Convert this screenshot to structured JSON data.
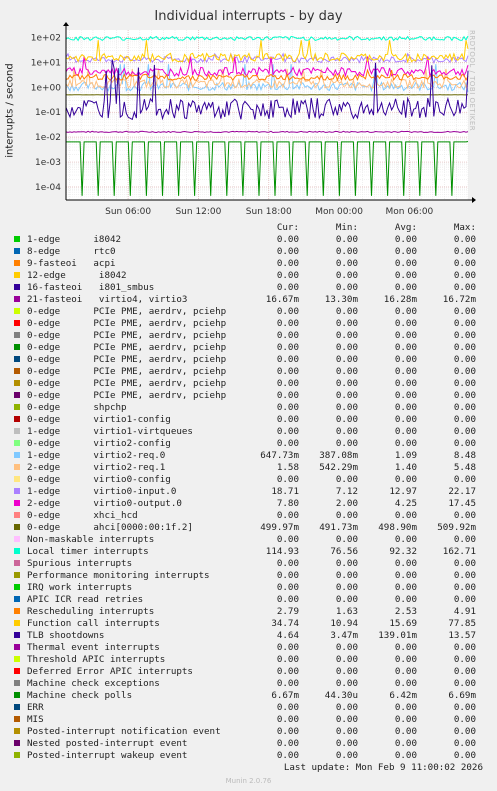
{
  "title": "Individual interrupts - by day",
  "side_label": "RRDTOOL / TOBI OETIKER",
  "footer": "Last update:  Mon Feb  9 11:00:02 2026",
  "munin": "Munin 2.0.76",
  "chart_data": {
    "type": "line",
    "yscale": "log",
    "ylabel": "interrupts / second",
    "ylim": [
      3e-05,
      200
    ],
    "yticks": [
      "1e+02",
      "1e+01",
      "1e+00",
      "1e-01",
      "1e-02",
      "1e-03",
      "1e-04"
    ],
    "ytick_values": [
      100,
      10,
      1,
      0.1,
      0.01,
      0.001,
      0.0001
    ],
    "xticks": [
      "Sun 06:00",
      "Sun 12:00",
      "Sun 18:00",
      "Mon 00:00",
      "Mon 06:00"
    ],
    "xtick_hours": [
      6,
      12,
      18,
      24,
      30
    ],
    "xlim_hours": [
      0.7,
      35.0
    ],
    "grid": true,
    "legend_columns": [
      "Cur:",
      "Min:",
      "Avg:",
      "Max:"
    ],
    "series": [
      {
        "name": "1-edge      i8042",
        "color": "#00cc00",
        "cur": "0.00",
        "min": "0.00",
        "avg": "0.00",
        "max": "0.00"
      },
      {
        "name": "8-edge      rtc0",
        "color": "#0066b3",
        "cur": "0.00",
        "min": "0.00",
        "avg": "0.00",
        "max": "0.00"
      },
      {
        "name": "9-fasteoi   acpi",
        "color": "#ff8000",
        "cur": "0.00",
        "min": "0.00",
        "avg": "0.00",
        "max": "0.00"
      },
      {
        "name": "12-edge      i8042",
        "color": "#ffcc00",
        "cur": "0.00",
        "min": "0.00",
        "avg": "0.00",
        "max": "0.00"
      },
      {
        "name": "16-fasteoi   i801_smbus",
        "color": "#330099",
        "cur": "0.00",
        "min": "0.00",
        "avg": "0.00",
        "max": "0.00"
      },
      {
        "name": "21-fasteoi   virtio4, virtio3",
        "color": "#990099",
        "cur": "16.67m",
        "min": "13.30m",
        "avg": "16.28m",
        "max": "16.72m"
      },
      {
        "name": "0-edge      PCIe PME, aerdrv, pciehp",
        "color": "#ccff00",
        "cur": "0.00",
        "min": "0.00",
        "avg": "0.00",
        "max": "0.00"
      },
      {
        "name": "0-edge      PCIe PME, aerdrv, pciehp",
        "color": "#ff0000",
        "cur": "0.00",
        "min": "0.00",
        "avg": "0.00",
        "max": "0.00"
      },
      {
        "name": "0-edge      PCIe PME, aerdrv, pciehp",
        "color": "#808080",
        "cur": "0.00",
        "min": "0.00",
        "avg": "0.00",
        "max": "0.00"
      },
      {
        "name": "0-edge      PCIe PME, aerdrv, pciehp",
        "color": "#008f00",
        "cur": "0.00",
        "min": "0.00",
        "avg": "0.00",
        "max": "0.00"
      },
      {
        "name": "0-edge      PCIe PME, aerdrv, pciehp",
        "color": "#00487d",
        "cur": "0.00",
        "min": "0.00",
        "avg": "0.00",
        "max": "0.00"
      },
      {
        "name": "0-edge      PCIe PME, aerdrv, pciehp",
        "color": "#b35a00",
        "cur": "0.00",
        "min": "0.00",
        "avg": "0.00",
        "max": "0.00"
      },
      {
        "name": "0-edge      PCIe PME, aerdrv, pciehp",
        "color": "#b38f00",
        "cur": "0.00",
        "min": "0.00",
        "avg": "0.00",
        "max": "0.00"
      },
      {
        "name": "0-edge      PCIe PME, aerdrv, pciehp",
        "color": "#6b006b",
        "cur": "0.00",
        "min": "0.00",
        "avg": "0.00",
        "max": "0.00"
      },
      {
        "name": "0-edge      shpchp",
        "color": "#8fb300",
        "cur": "0.00",
        "min": "0.00",
        "avg": "0.00",
        "max": "0.00"
      },
      {
        "name": "0-edge      virtio1-config",
        "color": "#b30000",
        "cur": "0.00",
        "min": "0.00",
        "avg": "0.00",
        "max": "0.00"
      },
      {
        "name": "1-edge      virtio1-virtqueues",
        "color": "#bebebe",
        "cur": "0.00",
        "min": "0.00",
        "avg": "0.00",
        "max": "0.00"
      },
      {
        "name": "0-edge      virtio2-config",
        "color": "#80ff80",
        "cur": "0.00",
        "min": "0.00",
        "avg": "0.00",
        "max": "0.00"
      },
      {
        "name": "1-edge      virtio2-req.0",
        "color": "#80c9ff",
        "cur": "647.73m",
        "min": "387.08m",
        "avg": "1.09",
        "max": "8.48"
      },
      {
        "name": "2-edge      virtio2-req.1",
        "color": "#ffc080",
        "cur": "1.58",
        "min": "542.29m",
        "avg": "1.40",
        "max": "5.48"
      },
      {
        "name": "0-edge      virtio0-config",
        "color": "#ffe680",
        "cur": "0.00",
        "min": "0.00",
        "avg": "0.00",
        "max": "0.00"
      },
      {
        "name": "1-edge      virtio0-input.0",
        "color": "#aa80ff",
        "cur": "18.71",
        "min": "7.12",
        "avg": "12.97",
        "max": "22.17"
      },
      {
        "name": "2-edge      virtio0-output.0",
        "color": "#ee00cc",
        "cur": "7.80",
        "min": "2.00",
        "avg": "4.25",
        "max": "17.45"
      },
      {
        "name": "0-edge      xhci_hcd",
        "color": "#ff8080",
        "cur": "0.00",
        "min": "0.00",
        "avg": "0.00",
        "max": "0.00"
      },
      {
        "name": "0-edge      ahci[0000:00:1f.2]",
        "color": "#666600",
        "cur": "499.97m",
        "min": "491.73m",
        "avg": "498.90m",
        "max": "509.92m"
      },
      {
        "name": "Non-maskable interrupts",
        "color": "#ffbfff",
        "cur": "0.00",
        "min": "0.00",
        "avg": "0.00",
        "max": "0.00"
      },
      {
        "name": "Local timer interrupts",
        "color": "#00ffcc",
        "cur": "114.93",
        "min": "76.56",
        "avg": "92.32",
        "max": "162.71"
      },
      {
        "name": "Spurious interrupts",
        "color": "#cc6699",
        "cur": "0.00",
        "min": "0.00",
        "avg": "0.00",
        "max": "0.00"
      },
      {
        "name": "Performance monitoring interrupts",
        "color": "#999900",
        "cur": "0.00",
        "min": "0.00",
        "avg": "0.00",
        "max": "0.00"
      },
      {
        "name": "IRQ work interrupts",
        "color": "#00cc00",
        "cur": "0.00",
        "min": "0.00",
        "avg": "0.00",
        "max": "0.00"
      },
      {
        "name": "APIC ICR read retries",
        "color": "#0066b3",
        "cur": "0.00",
        "min": "0.00",
        "avg": "0.00",
        "max": "0.00"
      },
      {
        "name": "Rescheduling interrupts",
        "color": "#ff8000",
        "cur": "2.79",
        "min": "1.63",
        "avg": "2.53",
        "max": "4.91"
      },
      {
        "name": "Function call interrupts",
        "color": "#ffcc00",
        "cur": "34.74",
        "min": "10.94",
        "avg": "15.69",
        "max": "77.85"
      },
      {
        "name": "TLB shootdowns",
        "color": "#330099",
        "cur": "4.64",
        "min": "3.47m",
        "avg": "139.01m",
        "max": "13.57"
      },
      {
        "name": "Thermal event interrupts",
        "color": "#990099",
        "cur": "0.00",
        "min": "0.00",
        "avg": "0.00",
        "max": "0.00"
      },
      {
        "name": "Threshold APIC interrupts",
        "color": "#ccff00",
        "cur": "0.00",
        "min": "0.00",
        "avg": "0.00",
        "max": "0.00"
      },
      {
        "name": "Deferred Error APIC interrupts",
        "color": "#ff0000",
        "cur": "0.00",
        "min": "0.00",
        "avg": "0.00",
        "max": "0.00"
      },
      {
        "name": "Machine check exceptions",
        "color": "#808080",
        "cur": "0.00",
        "min": "0.00",
        "avg": "0.00",
        "max": "0.00"
      },
      {
        "name": "Machine check polls",
        "color": "#008f00",
        "cur": "6.67m",
        "min": "44.30u",
        "avg": "6.42m",
        "max": "6.69m"
      },
      {
        "name": "ERR",
        "color": "#00487d",
        "cur": "0.00",
        "min": "0.00",
        "avg": "0.00",
        "max": "0.00"
      },
      {
        "name": "MIS",
        "color": "#b35a00",
        "cur": "0.00",
        "min": "0.00",
        "avg": "0.00",
        "max": "0.00"
      },
      {
        "name": "Posted-interrupt notification event",
        "color": "#b38f00",
        "cur": "0.00",
        "min": "0.00",
        "avg": "0.00",
        "max": "0.00"
      },
      {
        "name": "Nested posted-interrupt event",
        "color": "#6b006b",
        "cur": "0.00",
        "min": "0.00",
        "avg": "0.00",
        "max": "0.00"
      },
      {
        "name": "Posted-interrupt wakeup event",
        "color": "#8fb300",
        "cur": "0.00",
        "min": "0.00",
        "avg": "0.00",
        "max": "0.00"
      }
    ]
  }
}
